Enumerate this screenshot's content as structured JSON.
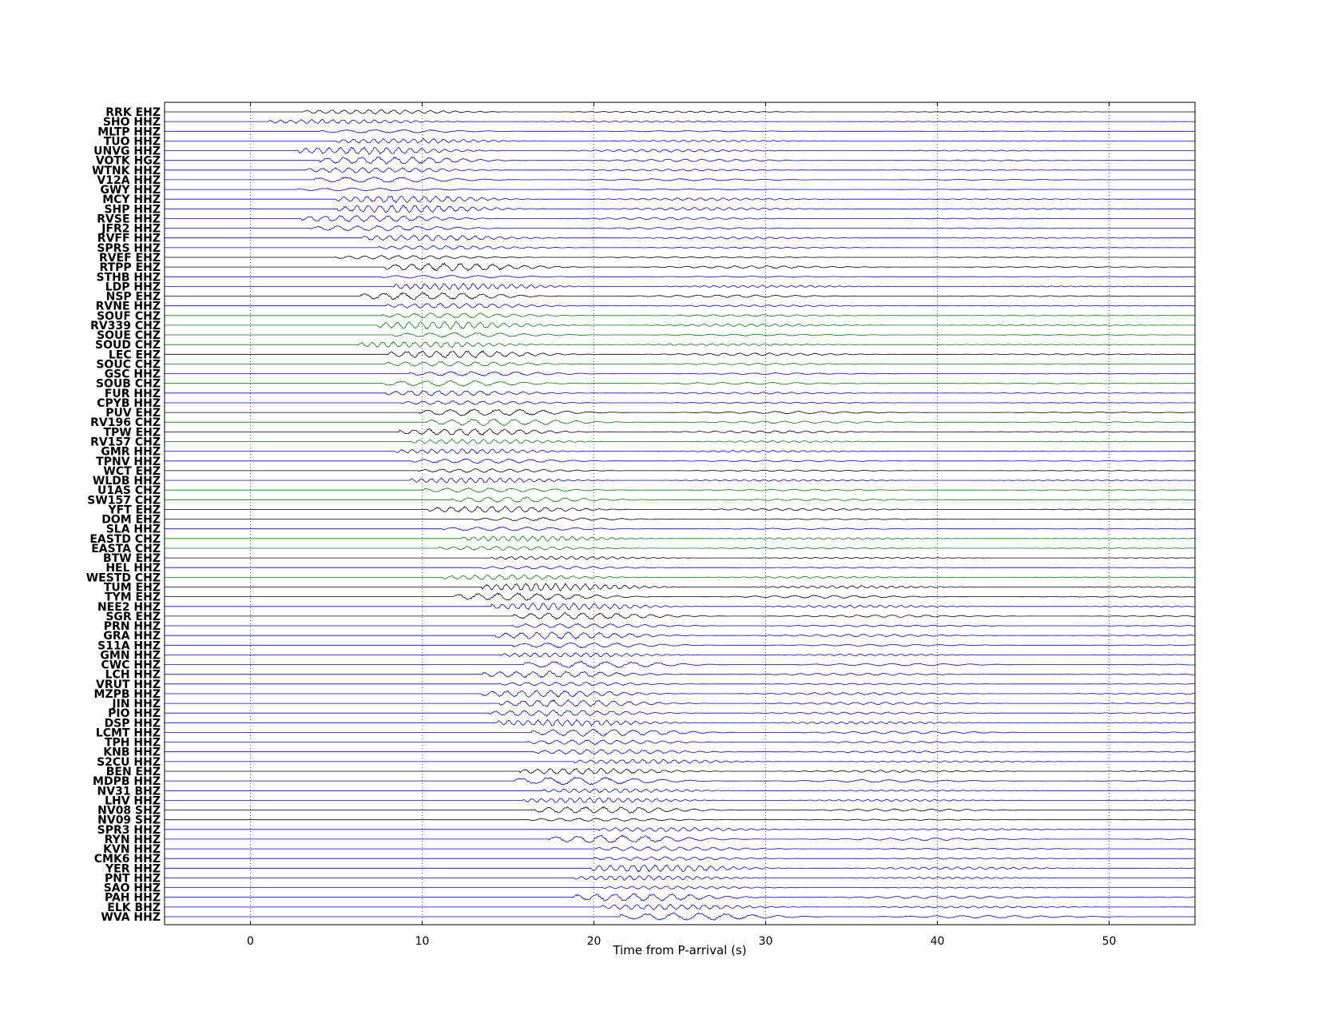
{
  "chart_data": {
    "type": "line",
    "title": "",
    "xlabel": "Time from P-arrival (s)",
    "ylabel": "",
    "xlim": [
      -5,
      55
    ],
    "xticks": [
      0,
      10,
      20,
      30,
      40,
      50
    ],
    "grid": "vertical dotted",
    "colors": {
      "HHZ": "#0000ff",
      "HGZ": "#0000ff",
      "BHZ": "#0000ff",
      "EHZ": "#000000",
      "SHZ": "#000000",
      "CHZ": "#008000"
    },
    "stations": [
      {
        "label": "RRK EHZ",
        "color": "#000000"
      },
      {
        "label": "SHO HHZ",
        "color": "#0000ff"
      },
      {
        "label": "MLTP HHZ",
        "color": "#0000ff"
      },
      {
        "label": "TUO HHZ",
        "color": "#0000ff"
      },
      {
        "label": "UNVG HHZ",
        "color": "#0000ff"
      },
      {
        "label": "VOTK HGZ",
        "color": "#0000ff"
      },
      {
        "label": "WTNK HHZ",
        "color": "#0000ff"
      },
      {
        "label": "V12A HHZ",
        "color": "#0000ff"
      },
      {
        "label": "GWY HHZ",
        "color": "#0000ff"
      },
      {
        "label": "MCY HHZ",
        "color": "#0000ff"
      },
      {
        "label": "SHP HHZ",
        "color": "#0000ff"
      },
      {
        "label": "RVSE HHZ",
        "color": "#0000ff"
      },
      {
        "label": "JFR2 HHZ",
        "color": "#0000ff"
      },
      {
        "label": "RVFF HHZ",
        "color": "#0000ff"
      },
      {
        "label": "SPRS HHZ",
        "color": "#0000ff"
      },
      {
        "label": "RVEF EHZ",
        "color": "#000000"
      },
      {
        "label": "RTPP EHZ",
        "color": "#000000"
      },
      {
        "label": "STHB HHZ",
        "color": "#0000ff"
      },
      {
        "label": "LDP HHZ",
        "color": "#0000ff"
      },
      {
        "label": "NSP EHZ",
        "color": "#000000"
      },
      {
        "label": "RVNE HHZ",
        "color": "#0000ff"
      },
      {
        "label": "SOUF CHZ",
        "color": "#008000"
      },
      {
        "label": "RV339 CHZ",
        "color": "#008000"
      },
      {
        "label": "SOUE CHZ",
        "color": "#008000"
      },
      {
        "label": "SOUD CHZ",
        "color": "#008000"
      },
      {
        "label": "LEC EHZ",
        "color": "#000000"
      },
      {
        "label": "SOUC CHZ",
        "color": "#008000"
      },
      {
        "label": "GSC HHZ",
        "color": "#0000ff"
      },
      {
        "label": "SOUB CHZ",
        "color": "#008000"
      },
      {
        "label": "FUR HHZ",
        "color": "#0000ff"
      },
      {
        "label": "CPYB HHZ",
        "color": "#0000ff"
      },
      {
        "label": "PUV EHZ",
        "color": "#000000"
      },
      {
        "label": "RV196 CHZ",
        "color": "#008000"
      },
      {
        "label": "TPW EHZ",
        "color": "#000000"
      },
      {
        "label": "RV157 CHZ",
        "color": "#008000"
      },
      {
        "label": "GMR HHZ",
        "color": "#0000ff"
      },
      {
        "label": "TPNV HHZ",
        "color": "#0000ff"
      },
      {
        "label": "WCT EHZ",
        "color": "#000000"
      },
      {
        "label": "WLDB HHZ",
        "color": "#0000ff"
      },
      {
        "label": "U1AS CHZ",
        "color": "#008000"
      },
      {
        "label": "SW157 CHZ",
        "color": "#008000"
      },
      {
        "label": "YFT EHZ",
        "color": "#000000"
      },
      {
        "label": "DOM EHZ",
        "color": "#000000"
      },
      {
        "label": "SLA HHZ",
        "color": "#0000ff"
      },
      {
        "label": "EASTD CHZ",
        "color": "#008000"
      },
      {
        "label": "EASTA CHZ",
        "color": "#008000"
      },
      {
        "label": "BTW EHZ",
        "color": "#000000"
      },
      {
        "label": "HEL HHZ",
        "color": "#0000ff"
      },
      {
        "label": "WESTD CHZ",
        "color": "#008000"
      },
      {
        "label": "TUM EHZ",
        "color": "#000000"
      },
      {
        "label": "TYM EHZ",
        "color": "#000000"
      },
      {
        "label": "NEE2 HHZ",
        "color": "#0000ff"
      },
      {
        "label": "SGR EHZ",
        "color": "#000000"
      },
      {
        "label": "PRN HHZ",
        "color": "#0000ff"
      },
      {
        "label": "GRA HHZ",
        "color": "#0000ff"
      },
      {
        "label": "S11A HHZ",
        "color": "#0000ff"
      },
      {
        "label": "GMN HHZ",
        "color": "#0000ff"
      },
      {
        "label": "CWC HHZ",
        "color": "#0000ff"
      },
      {
        "label": "LCH HHZ",
        "color": "#0000ff"
      },
      {
        "label": "VRUT HHZ",
        "color": "#0000ff"
      },
      {
        "label": "MZPB HHZ",
        "color": "#0000ff"
      },
      {
        "label": "JIN HHZ",
        "color": "#0000ff"
      },
      {
        "label": "PIO HHZ",
        "color": "#0000ff"
      },
      {
        "label": "DSP HHZ",
        "color": "#0000ff"
      },
      {
        "label": "LCMT HHZ",
        "color": "#0000ff"
      },
      {
        "label": "TPH HHZ",
        "color": "#0000ff"
      },
      {
        "label": "KNB HHZ",
        "color": "#0000ff"
      },
      {
        "label": "S2CU HHZ",
        "color": "#0000ff"
      },
      {
        "label": "BEN EHZ",
        "color": "#000000"
      },
      {
        "label": "MDPB HHZ",
        "color": "#0000ff"
      },
      {
        "label": "NV31 BHZ",
        "color": "#0000ff"
      },
      {
        "label": "LHV HHZ",
        "color": "#0000ff"
      },
      {
        "label": "NV08 SHZ",
        "color": "#000000"
      },
      {
        "label": "NV09 SHZ",
        "color": "#000000"
      },
      {
        "label": "SPR3 HHZ",
        "color": "#0000ff"
      },
      {
        "label": "RYN HHZ",
        "color": "#0000ff"
      },
      {
        "label": "KVN HHZ",
        "color": "#0000ff"
      },
      {
        "label": "CMK6 HHZ",
        "color": "#0000ff"
      },
      {
        "label": "YER HHZ",
        "color": "#0000ff"
      },
      {
        "label": "PNT HHZ",
        "color": "#0000ff"
      },
      {
        "label": "SAO HHZ",
        "color": "#0000ff"
      },
      {
        "label": "PAH HHZ",
        "color": "#0000ff"
      },
      {
        "label": "ELK BHZ",
        "color": "#0000ff"
      },
      {
        "label": "WVA HHZ",
        "color": "#0000ff"
      }
    ]
  }
}
